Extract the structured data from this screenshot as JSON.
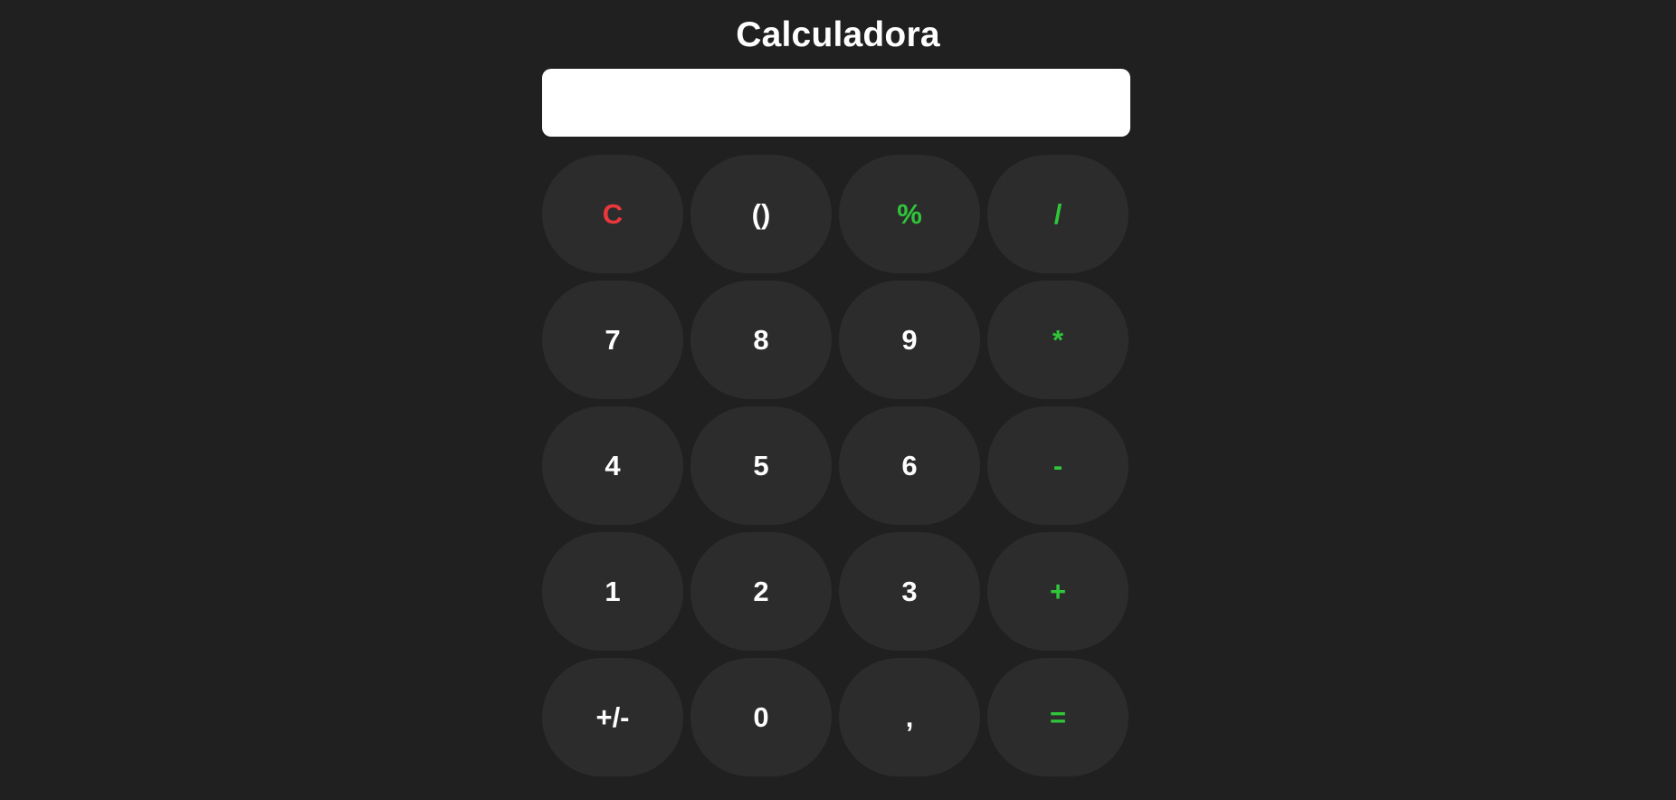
{
  "app": {
    "title": "Calculadora"
  },
  "display": {
    "value": "",
    "placeholder": ""
  },
  "colors": {
    "background": "#212021",
    "key_background": "#2c2c2c",
    "clear": "#e8383c",
    "operator": "#2fc63a",
    "digit": "#ffffff"
  },
  "keys": [
    {
      "label": "C",
      "type": "clear",
      "name": "clear-button"
    },
    {
      "label": "()",
      "type": "digit",
      "name": "parentheses-button"
    },
    {
      "label": "%",
      "type": "op",
      "name": "percent-button"
    },
    {
      "label": "/",
      "type": "op",
      "name": "divide-button"
    },
    {
      "label": "7",
      "type": "digit",
      "name": "digit-7-button"
    },
    {
      "label": "8",
      "type": "digit",
      "name": "digit-8-button"
    },
    {
      "label": "9",
      "type": "digit",
      "name": "digit-9-button"
    },
    {
      "label": "*",
      "type": "op",
      "name": "multiply-button"
    },
    {
      "label": "4",
      "type": "digit",
      "name": "digit-4-button"
    },
    {
      "label": "5",
      "type": "digit",
      "name": "digit-5-button"
    },
    {
      "label": "6",
      "type": "digit",
      "name": "digit-6-button"
    },
    {
      "label": "-",
      "type": "op",
      "name": "subtract-button"
    },
    {
      "label": "1",
      "type": "digit",
      "name": "digit-1-button"
    },
    {
      "label": "2",
      "type": "digit",
      "name": "digit-2-button"
    },
    {
      "label": "3",
      "type": "digit",
      "name": "digit-3-button"
    },
    {
      "label": "+",
      "type": "op",
      "name": "add-button"
    },
    {
      "label": "+/-",
      "type": "digit",
      "name": "toggle-sign-button"
    },
    {
      "label": "0",
      "type": "digit",
      "name": "digit-0-button"
    },
    {
      "label": ",",
      "type": "digit",
      "name": "decimal-button"
    },
    {
      "label": "=",
      "type": "op",
      "name": "equals-button"
    }
  ]
}
